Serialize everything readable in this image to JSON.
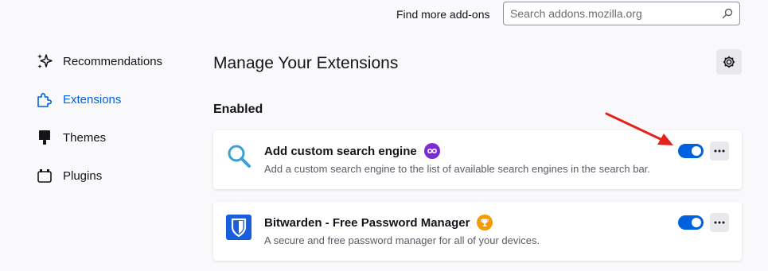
{
  "header": {
    "find_more_label": "Find more add-ons",
    "search_placeholder": "Search addons.mozilla.org",
    "search_value": ""
  },
  "sidebar": {
    "items": [
      {
        "label": "Recommendations",
        "icon": "sparkle-icon",
        "active": false
      },
      {
        "label": "Extensions",
        "icon": "puzzle-icon",
        "active": true
      },
      {
        "label": "Themes",
        "icon": "paintbrush-icon",
        "active": false
      },
      {
        "label": "Plugins",
        "icon": "plugin-icon",
        "active": false
      }
    ]
  },
  "main": {
    "title": "Manage Your Extensions",
    "section_label": "Enabled",
    "extensions": [
      {
        "name": "Add custom search engine",
        "description": "Add a custom search engine to the list of available search engines in the search bar.",
        "icon": "magnifier-icon",
        "badge": "infinity-badge-icon",
        "enabled": true
      },
      {
        "name": "Bitwarden - Free Password Manager",
        "description": "A secure and free password manager for all of your devices.",
        "icon": "bitwarden-shield-icon",
        "badge": "trophy-badge-icon",
        "enabled": true
      }
    ]
  },
  "colors": {
    "accent": "#0061e0",
    "annotation_arrow": "#e8201a",
    "badge_purple": "#7b2bd6",
    "badge_orange": "#f59a00",
    "bitwarden_blue": "#175ddc"
  }
}
